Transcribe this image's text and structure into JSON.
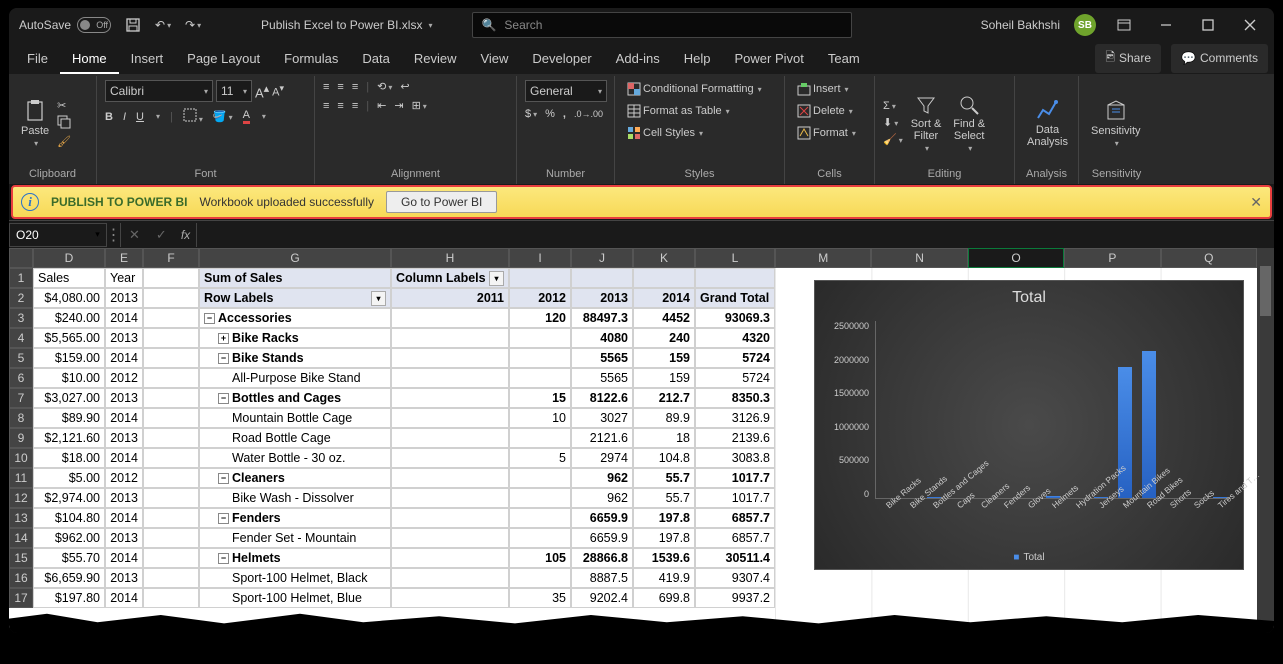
{
  "title": {
    "autosave": "AutoSave",
    "autosave_state": "Off",
    "filename": "Publish Excel to Power BI.xlsx",
    "search_placeholder": "Search",
    "username": "Soheil Bakhshi",
    "avatar": "SB"
  },
  "tabs": {
    "items": [
      "File",
      "Home",
      "Insert",
      "Page Layout",
      "Formulas",
      "Data",
      "Review",
      "View",
      "Developer",
      "Add-ins",
      "Help",
      "Power Pivot",
      "Team"
    ],
    "active": "Home",
    "share": "Share",
    "comments": "Comments"
  },
  "ribbon": {
    "clipboard": {
      "label": "Clipboard",
      "paste": "Paste"
    },
    "font": {
      "label": "Font",
      "name": "Calibri",
      "size": "11"
    },
    "alignment": {
      "label": "Alignment"
    },
    "number": {
      "label": "Number",
      "format": "General"
    },
    "styles": {
      "label": "Styles",
      "cond": "Conditional Formatting",
      "table": "Format as Table",
      "cell": "Cell Styles"
    },
    "cells": {
      "label": "Cells",
      "insert": "Insert",
      "delete": "Delete",
      "format": "Format"
    },
    "editing": {
      "label": "Editing",
      "sort": "Sort &\nFilter",
      "find": "Find &\nSelect"
    },
    "analysis": {
      "label": "Analysis",
      "data": "Data\nAnalysis"
    },
    "sensitivity": {
      "label": "Sensitivity",
      "btn": "Sensitivity"
    }
  },
  "messagebar": {
    "title": "PUBLISH TO POWER BI",
    "text": "Workbook uploaded successfully",
    "button": "Go to Power BI"
  },
  "namebox": "O20",
  "columns": [
    "D",
    "E",
    "F",
    "G",
    "H",
    "I",
    "J",
    "K",
    "L"
  ],
  "extra_columns": [
    "M",
    "N",
    "O",
    "P",
    "Q"
  ],
  "rows": [
    {
      "n": 1,
      "d": "Sales",
      "e": "Year",
      "g": "Sum of Sales",
      "h": "Column Labels",
      "hdd": true,
      "hl": true,
      "b": true
    },
    {
      "n": 2,
      "d": "$4,080.00",
      "e": "2013",
      "g": "Row Labels",
      "gdd": true,
      "h": "2011",
      "i": "2012",
      "j": "2013",
      "k": "2014",
      "l": "Grand Total",
      "hl": true,
      "b": true
    },
    {
      "n": 3,
      "d": "$240.00",
      "e": "2014",
      "g": "Accessories",
      "exp": "-",
      "i": "120",
      "j": "88497.3",
      "k": "4452",
      "l": "93069.3",
      "b": true
    },
    {
      "n": 4,
      "d": "$5,565.00",
      "e": "2013",
      "g": "Bike Racks",
      "ind": 1,
      "exp": "+",
      "j": "4080",
      "k": "240",
      "l": "4320",
      "b": true
    },
    {
      "n": 5,
      "d": "$159.00",
      "e": "2014",
      "g": "Bike Stands",
      "ind": 1,
      "exp": "-",
      "j": "5565",
      "k": "159",
      "l": "5724",
      "b": true
    },
    {
      "n": 6,
      "d": "$10.00",
      "e": "2012",
      "g": "All-Purpose Bike Stand",
      "ind": 2,
      "j": "5565",
      "k": "159",
      "l": "5724"
    },
    {
      "n": 7,
      "d": "$3,027.00",
      "e": "2013",
      "g": "Bottles and Cages",
      "ind": 1,
      "exp": "-",
      "i": "15",
      "j": "8122.6",
      "k": "212.7",
      "l": "8350.3",
      "b": true
    },
    {
      "n": 8,
      "d": "$89.90",
      "e": "2014",
      "g": "Mountain Bottle Cage",
      "ind": 2,
      "i": "10",
      "j": "3027",
      "k": "89.9",
      "l": "3126.9"
    },
    {
      "n": 9,
      "d": "$2,121.60",
      "e": "2013",
      "g": "Road Bottle Cage",
      "ind": 2,
      "j": "2121.6",
      "k": "18",
      "l": "2139.6"
    },
    {
      "n": 10,
      "d": "$18.00",
      "e": "2014",
      "g": "Water Bottle - 30 oz.",
      "ind": 2,
      "i": "5",
      "j": "2974",
      "k": "104.8",
      "l": "3083.8"
    },
    {
      "n": 11,
      "d": "$5.00",
      "e": "2012",
      "g": "Cleaners",
      "ind": 1,
      "exp": "-",
      "j": "962",
      "k": "55.7",
      "l": "1017.7",
      "b": true
    },
    {
      "n": 12,
      "d": "$2,974.00",
      "e": "2013",
      "g": "Bike Wash - Dissolver",
      "ind": 2,
      "j": "962",
      "k": "55.7",
      "l": "1017.7"
    },
    {
      "n": 13,
      "d": "$104.80",
      "e": "2014",
      "g": "Fenders",
      "ind": 1,
      "exp": "-",
      "j": "6659.9",
      "k": "197.8",
      "l": "6857.7",
      "b": true
    },
    {
      "n": 14,
      "d": "$962.00",
      "e": "2013",
      "g": "Fender Set - Mountain",
      "ind": 2,
      "j": "6659.9",
      "k": "197.8",
      "l": "6857.7"
    },
    {
      "n": 15,
      "d": "$55.70",
      "e": "2014",
      "g": "Helmets",
      "ind": 1,
      "exp": "-",
      "i": "105",
      "j": "28866.8",
      "k": "1539.6",
      "l": "30511.4",
      "b": true
    },
    {
      "n": 16,
      "d": "$6,659.90",
      "e": "2013",
      "g": "Sport-100 Helmet, Black",
      "ind": 2,
      "j": "8887.5",
      "k": "419.9",
      "l": "9307.4"
    },
    {
      "n": 17,
      "d": "$197.80",
      "e": "2014",
      "g": "Sport-100 Helmet, Blue",
      "ind": 2,
      "i": "35",
      "j": "9202.4",
      "k": "699.8",
      "l": "9937.2"
    }
  ],
  "chart_data": {
    "type": "bar",
    "title": "Total",
    "ylabel": "",
    "ylim": [
      0,
      2500000
    ],
    "yticks": [
      0,
      500000,
      1000000,
      1500000,
      2000000,
      2500000
    ],
    "categories": [
      "Bike Racks",
      "Bike Stands",
      "Bottles and Cages",
      "Caps",
      "Cleaners",
      "Fenders",
      "Gloves",
      "Helmets",
      "Hydration Packs",
      "Jerseys",
      "Mountain Bikes",
      "Road Bikes",
      "Shorts",
      "Socks",
      "Tires and T…"
    ],
    "series": [
      {
        "name": "Total",
        "values": [
          4320,
          5724,
          8350,
          3000,
          1017,
          6857,
          5000,
          30511,
          4000,
          8000,
          1850000,
          2080000,
          7000,
          3000,
          12000
        ]
      }
    ],
    "legend": "Total"
  }
}
